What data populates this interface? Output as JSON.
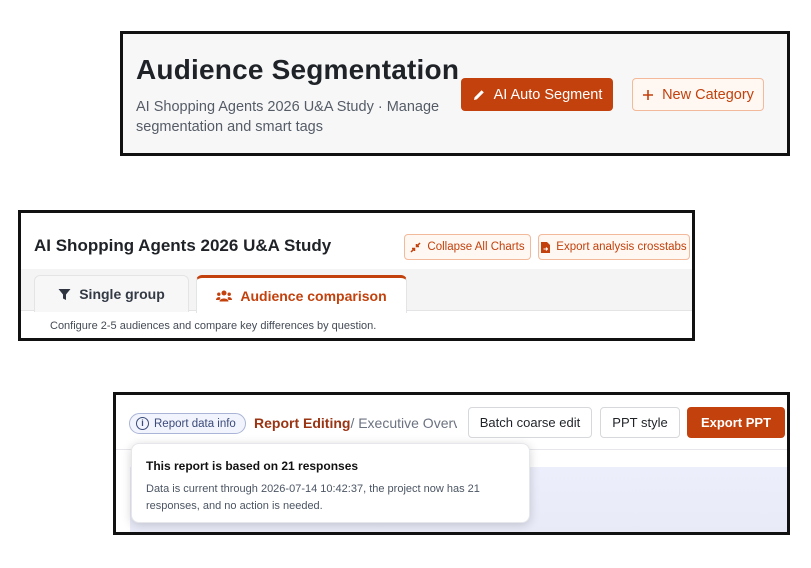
{
  "segmentation": {
    "title": "Audience Segmentation",
    "description": "AI Shopping Agents 2026 U&A Study · Manage segmentation and smart tags",
    "auto_segment_label": "AI Auto Segment",
    "new_category_label": "New Category"
  },
  "analysis": {
    "title": "AI Shopping Agents 2026 U&A Study",
    "collapse_label": "Collapse All Charts",
    "export_label": "Export analysis crosstabs",
    "tabs": [
      {
        "label": "Single group",
        "icon": "filter-icon",
        "active": false
      },
      {
        "label": "Audience comparison",
        "icon": "users-icon",
        "active": true
      }
    ],
    "hint": "Configure 2-5 audiences and compare key differences by question."
  },
  "report": {
    "info_chip_label": "Report data info",
    "breadcrumb_current": "Report Editing",
    "breadcrumb_rest": "/ Executive Overv",
    "batch_edit_label": "Batch coarse edit",
    "ppt_style_label": "PPT style",
    "export_ppt_label": "Export PPT",
    "popover": {
      "title": "This report is based on 21 responses",
      "body": "Data is current through 2026-07-14 10:42:37, the project now has 21 responses, and no action is needed."
    }
  },
  "colors": {
    "accent": "#c2410c",
    "accent_light": "#fff7f2",
    "info_chip": "#3b4a7a"
  }
}
